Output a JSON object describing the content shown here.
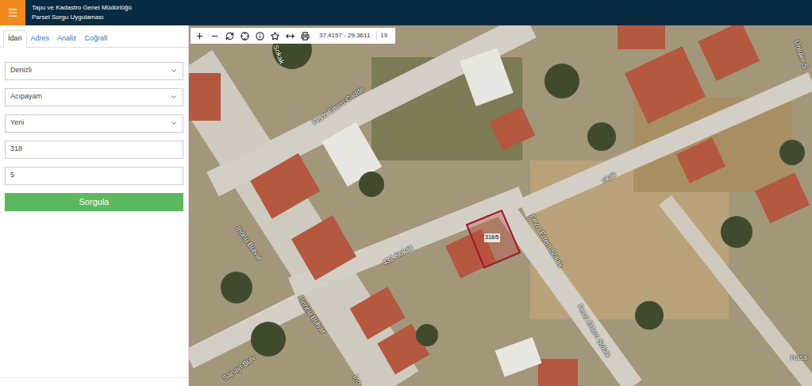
{
  "header": {
    "title": "Tapu ve Kadastro Genel Müdürlüğü",
    "subtitle": "Parsel Sorgu Uygulaması"
  },
  "tabs": [
    {
      "label": "İdari",
      "selected": true
    },
    {
      "label": "Adres",
      "selected": false
    },
    {
      "label": "Analiz",
      "selected": false
    },
    {
      "label": "Coğrafi",
      "selected": false
    }
  ],
  "form": {
    "fields": [
      {
        "kind": "select",
        "value": "Denizli"
      },
      {
        "kind": "select",
        "value": "Acıpayam"
      },
      {
        "kind": "select",
        "value": "Yeni"
      },
      {
        "kind": "input",
        "value": "318"
      },
      {
        "kind": "input",
        "value": "5"
      }
    ],
    "submit": "Sorgula"
  },
  "map": {
    "toolbar": {
      "coordinates": "37.4157 - 29.3611",
      "zoom": "19"
    },
    "labels": [
      {
        "text": "Sokak"
      },
      {
        "text": "Fevzi Ertem Cadde"
      },
      {
        "text": "432 Sokak"
      },
      {
        "text": "Fevzi Ertem Sokak"
      },
      {
        "text": "Fevzi Ertem Sokak"
      },
      {
        "text": "okak"
      },
      {
        "text": "Ünlüler S"
      },
      {
        "text": "İnönü Bulvar"
      },
      {
        "text": "İnönü Bulvar"
      },
      {
        "text": "Sanayi Bulv"
      },
      {
        "text": "İnö"
      },
      {
        "text": "Hasa"
      }
    ],
    "parcel": {
      "label": "318/5"
    }
  }
}
